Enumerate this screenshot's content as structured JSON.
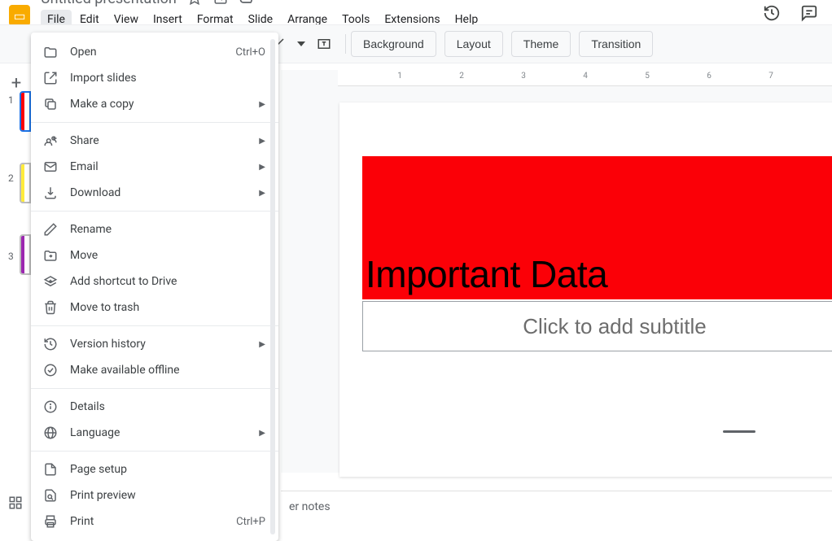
{
  "doc_title": "Untitled presentation",
  "menus": [
    "File",
    "Edit",
    "View",
    "Insert",
    "Format",
    "Slide",
    "Arrange",
    "Tools",
    "Extensions",
    "Help"
  ],
  "toolbar": {
    "background": "Background",
    "layout": "Layout",
    "theme": "Theme",
    "transition": "Transition"
  },
  "ruler": [
    1,
    2,
    3,
    4,
    5,
    6,
    7
  ],
  "slide_numbers": [
    1,
    2,
    3
  ],
  "thumb_colors": [
    "#fb0007",
    "#ffeb3b",
    "#9c27b0"
  ],
  "slide": {
    "title_text": "Important Data",
    "subtitle_placeholder": "Click to add subtitle"
  },
  "speaker_notes_suffix": "er notes",
  "file_menu": [
    {
      "icon": "folder",
      "label": "Open",
      "hint": "Ctrl+O"
    },
    {
      "icon": "import",
      "label": "Import slides",
      "hint": ""
    },
    {
      "icon": "copy",
      "label": "Make a copy",
      "hint": "",
      "submenu": true
    },
    "---",
    {
      "icon": "share",
      "label": "Share",
      "hint": "",
      "submenu": true
    },
    {
      "icon": "email",
      "label": "Email",
      "hint": "",
      "submenu": true
    },
    {
      "icon": "download",
      "label": "Download",
      "hint": "",
      "submenu": true
    },
    "---",
    {
      "icon": "rename",
      "label": "Rename",
      "hint": ""
    },
    {
      "icon": "move",
      "label": "Move",
      "hint": ""
    },
    {
      "icon": "shortcut",
      "label": "Add shortcut to Drive",
      "hint": ""
    },
    {
      "icon": "trash",
      "label": "Move to trash",
      "hint": ""
    },
    "---",
    {
      "icon": "history",
      "label": "Version history",
      "hint": "",
      "submenu": true
    },
    {
      "icon": "offline",
      "label": "Make available offline",
      "hint": ""
    },
    "---",
    {
      "icon": "info",
      "label": "Details",
      "hint": ""
    },
    {
      "icon": "language",
      "label": "Language",
      "hint": "",
      "submenu": true
    },
    "---",
    {
      "icon": "page",
      "label": "Page setup",
      "hint": ""
    },
    {
      "icon": "preview",
      "label": "Print preview",
      "hint": ""
    },
    {
      "icon": "print",
      "label": "Print",
      "hint": "Ctrl+P"
    }
  ]
}
